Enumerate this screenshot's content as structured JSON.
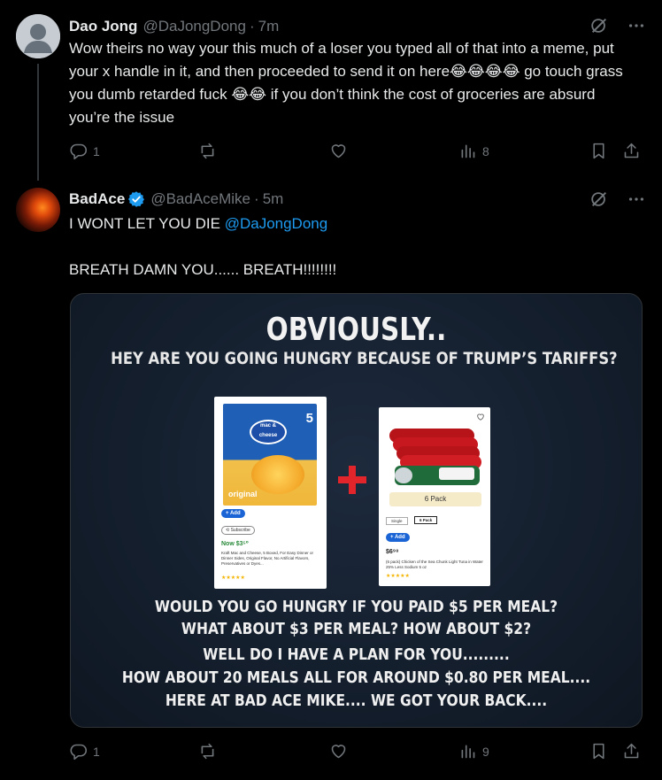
{
  "tweets": [
    {
      "name": "Dao Jong",
      "handle": "@DaJongDong",
      "dot": "·",
      "time": "7m",
      "text": "Wow theirs no way your this much of a loser you typed all of that into a meme, put your x handle in it, and then proceeded to send it on here😂😂😂😂 go touch grass you dumb retarded fuck 😂😂 if you don’t think the cost of groceries are absurd you’re the issue",
      "replies": "1",
      "retweets": "",
      "likes": "",
      "views": "8"
    },
    {
      "name": "BadAce",
      "verified": true,
      "handle": "@BadAceMike",
      "dot": "·",
      "time": "5m",
      "text_line1": "I WONT LET YOU DIE ",
      "mention": "@DaJongDong",
      "text_line2": "BREATH DAMN YOU...... BREATH!!!!!!!!",
      "replies": "1",
      "retweets": "",
      "likes": "",
      "views": "9",
      "media": {
        "title": "OBVIOUSLY..",
        "subtitle": "HEY ARE YOU GOING HUNGRY BECAUSE OF TRUMP’S TARIFFS?",
        "product1": {
          "box_logo": "mac & cheese",
          "box_count": "5",
          "box_flavor": "original",
          "add": "+ Add",
          "subscribe": "⟲ Subscribe",
          "price": "Now $3⁵⁰",
          "desc": "Kraft Mac and Cheese, 5 Boxed, For Easy Dinner or Dinner Sides, Original Flavor, No Artificial Flavors, Preservatives or Dyes...",
          "stars": "★★★★★"
        },
        "product2": {
          "pack": "6 Pack",
          "opt_single": "Single",
          "opt_6pack": "6 Pack",
          "add": "+ Add",
          "price": "$6⁹⁸",
          "desc": "(6 pack) Chicken of the Sea Chunk Light Tuna in Water 25% Less Sodium 5 oz",
          "stars": "★★★★★"
        },
        "lines": [
          "WOULD YOU GO HUNGRY IF YOU PAID $5 PER MEAL?",
          "WHAT ABOUT $3 PER MEAL? HOW ABOUT $2?",
          "WELL DO I HAVE A PLAN FOR YOU.........",
          "HOW ABOUT 20 MEALS ALL FOR AROUND $0.80 PER MEAL....",
          "HERE AT BAD ACE MIKE.... WE GOT YOUR BACK...."
        ]
      }
    }
  ],
  "icons": {
    "grok": "grok-icon",
    "more": "more-icon",
    "reply": "reply-icon",
    "retweet": "retweet-icon",
    "like": "heart-icon",
    "views": "views-icon",
    "bookmark": "bookmark-icon",
    "share": "share-icon"
  },
  "colors": {
    "background": "#000000",
    "text": "#e7e9ea",
    "muted": "#71767b",
    "accent": "#1d9bf0"
  }
}
